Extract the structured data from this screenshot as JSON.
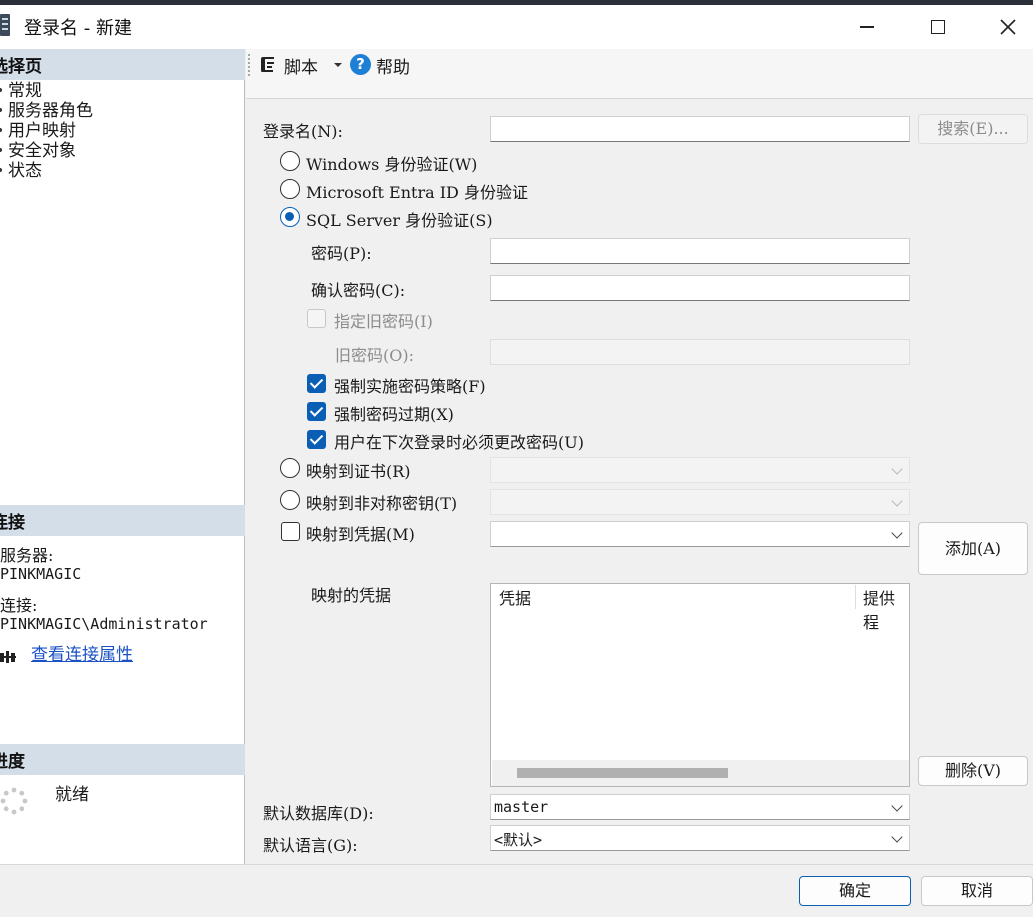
{
  "window": {
    "title": "登录名 - 新建",
    "icon": "server-icon"
  },
  "left_panel": {
    "select_page_header": "选择页",
    "pages": [
      "常规",
      "服务器角色",
      "用户映射",
      "安全对象",
      "状态"
    ],
    "connection_header": "连接",
    "server_label": "服务器:",
    "server_value": "PINKMAGIC",
    "connection_label": "连接:",
    "connection_value": "PINKMAGIC\\Administrator",
    "view_properties_link": "查看连接属性",
    "progress_header": "进度",
    "progress_status": "就绪"
  },
  "toolbar": {
    "script_label": "脚本",
    "help_label": "帮助"
  },
  "form": {
    "login_name_label": "登录名(N):",
    "login_name_value": "",
    "search_button": "搜索(E)...",
    "auth_windows": "Windows 身份验证(W)",
    "auth_entra": "Microsoft Entra ID 身份验证",
    "auth_sql": "SQL Server 身份验证(S)",
    "auth_selected": "sql",
    "password_label": "密码(P):",
    "confirm_password_label": "确认密码(C):",
    "specify_old_password": "指定旧密码(I)",
    "old_password_label": "旧密码(O):",
    "enforce_policy": "强制实施密码策略(F)",
    "enforce_expiration": "强制密码过期(X)",
    "must_change": "用户在下次登录时必须更改密码(U)",
    "map_certificate": "映射到证书(R)",
    "map_asymmetric_key": "映射到非对称密钥(T)",
    "map_credential": "映射到凭据(M)",
    "add_button": "添加(A)",
    "mapped_credentials_label": "映射的凭据",
    "grid_col_credential": "凭据",
    "grid_col_provider": "提供程",
    "remove_button": "删除(V)",
    "default_db_label": "默认数据库(D):",
    "default_db_value": "master",
    "default_lang_label": "默认语言(G):",
    "default_lang_value": "<默认>"
  },
  "footer": {
    "ok_button": "确定",
    "cancel_button": "取消"
  },
  "colors": {
    "accent": "#0a5fb4",
    "section_header": "#d4dee9",
    "link": "#1a52c4"
  }
}
